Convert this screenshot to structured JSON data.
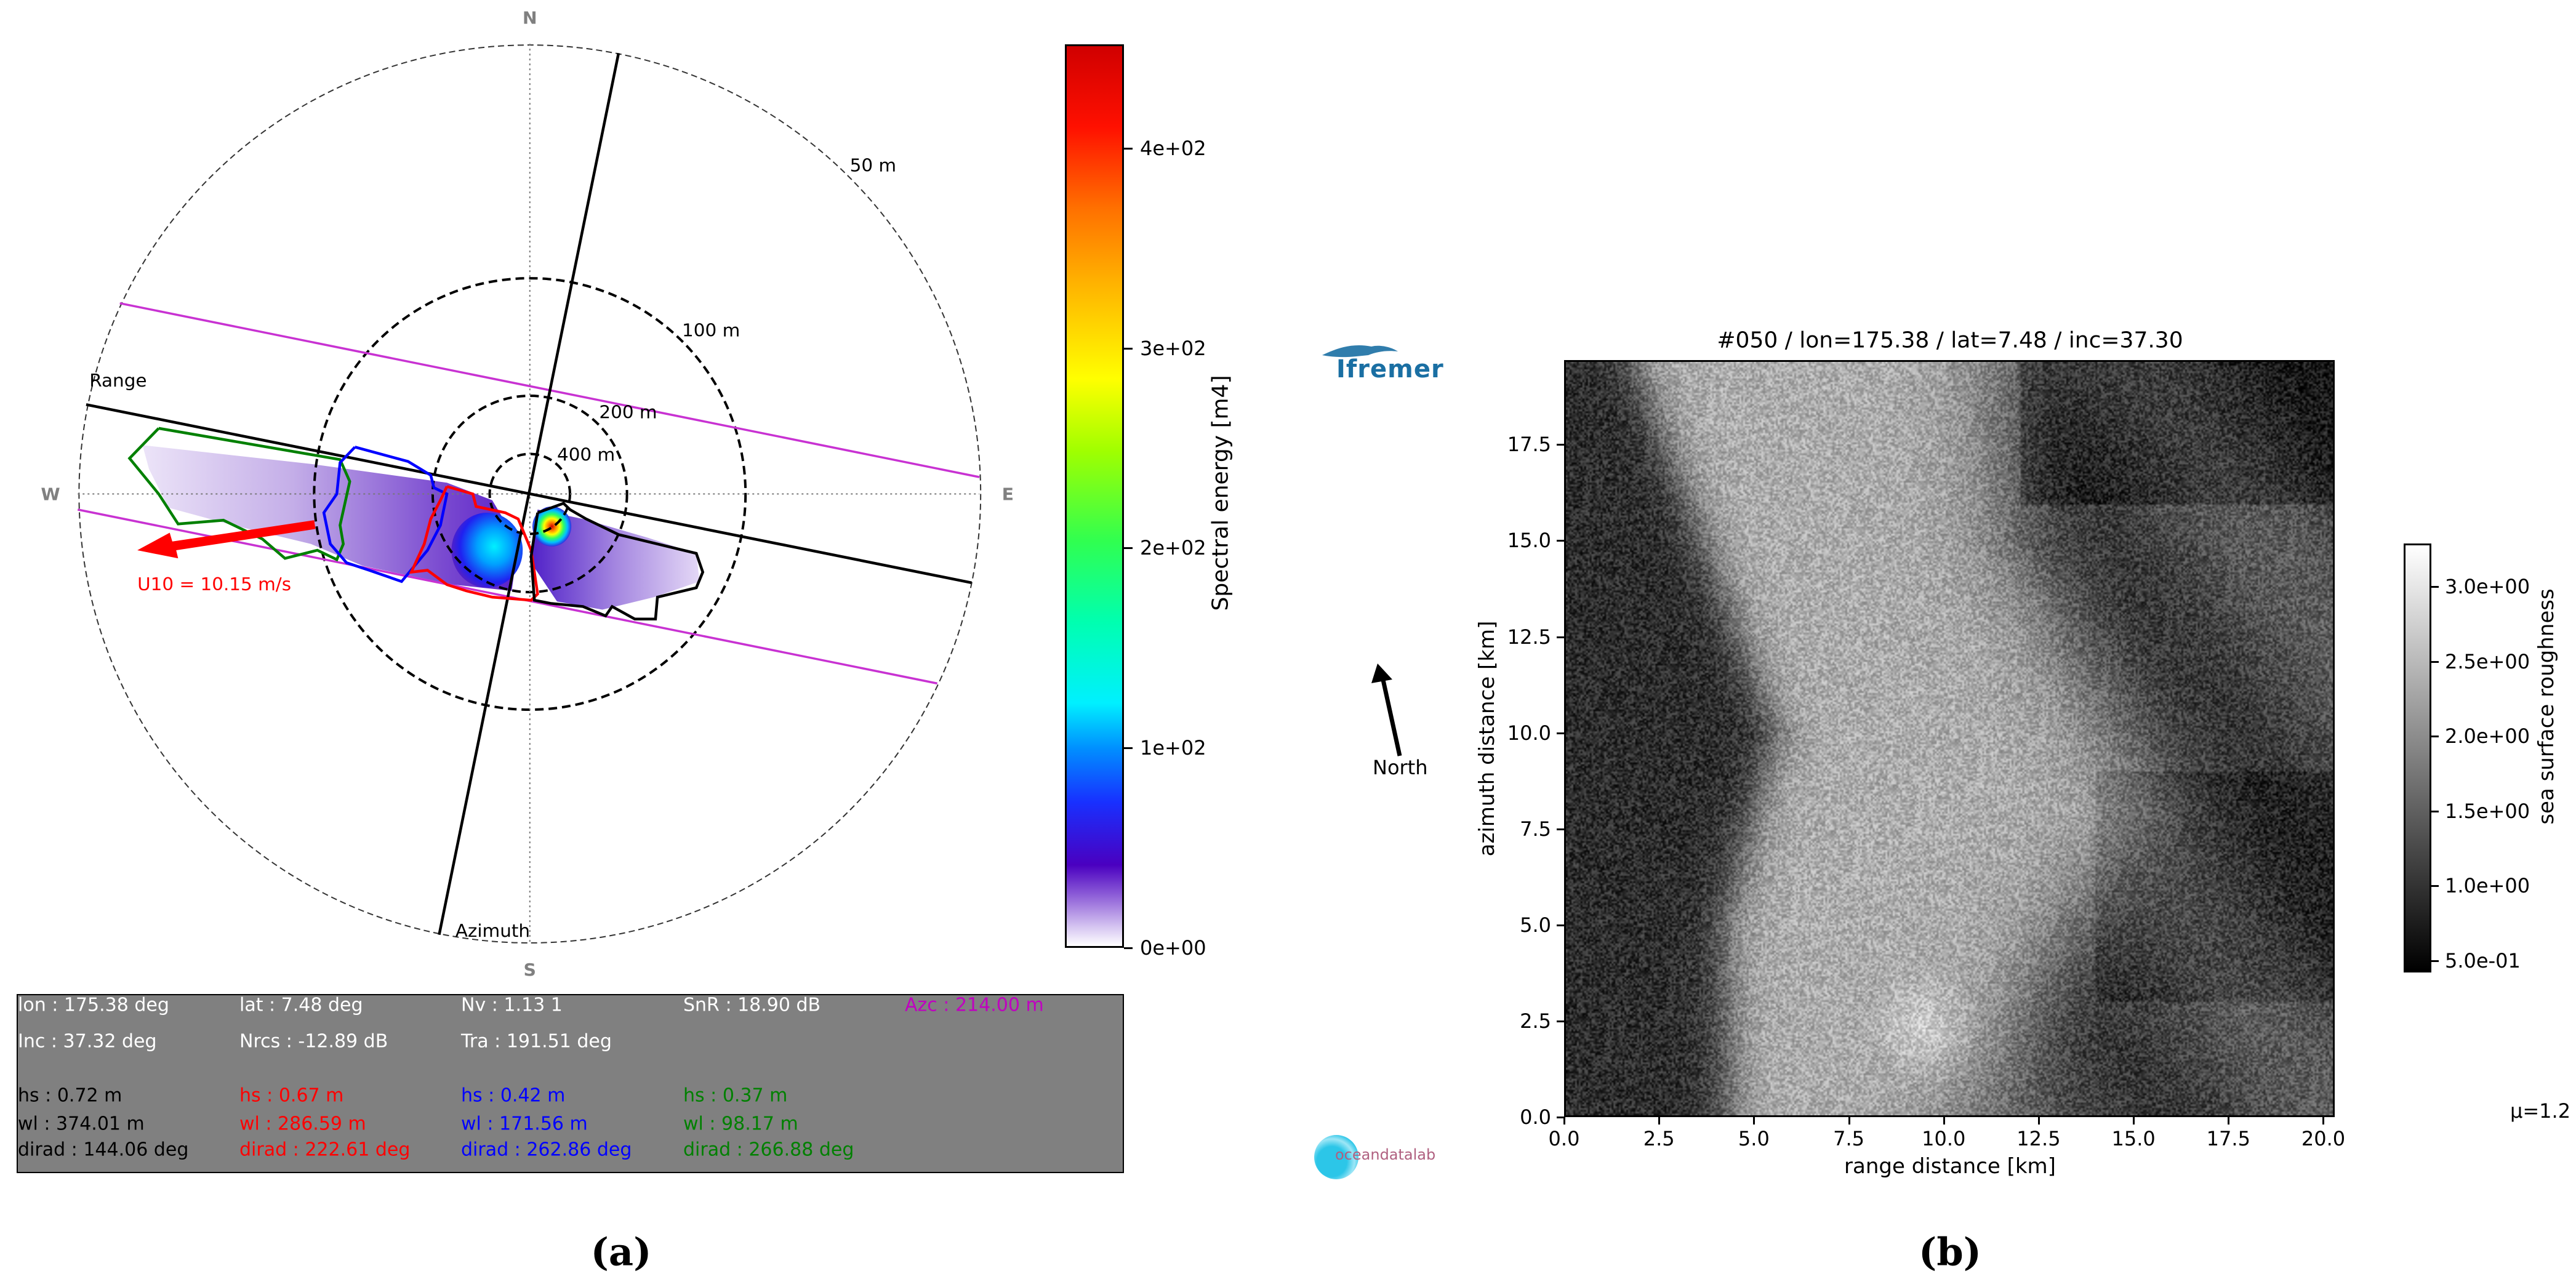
{
  "colors": {
    "hot": "#ff0000",
    "blue": "#0000ff",
    "green": "#008000",
    "magenta": "#c000c0",
    "black": "#000000",
    "panel": "#808080",
    "ifremer": "#1a6fa3",
    "odl_text": "#b06080",
    "odl_globe": "#2cc6e8"
  },
  "polar": {
    "compass": {
      "n": "N",
      "s": "S",
      "w": "W",
      "e": "E"
    },
    "rings": [
      "50 m",
      "100 m",
      "200 m",
      "400 m"
    ],
    "range_label": "Range",
    "azimuth_label": "Azimuth",
    "wind_label": "U10 = 10.15 m/s"
  },
  "info": {
    "row1": [
      "lon : 175.38 deg",
      "lat : 7.48 deg",
      "Nv : 1.13 1",
      "SnR : 18.90 dB",
      "Azc : 214.00 m"
    ],
    "row2": [
      "Inc : 37.32 deg",
      "Nrcs : -12.89 dB",
      "Tra : 191.51 deg"
    ],
    "partitions": [
      {
        "hs": "hs : 0.72 m",
        "wl": "wl : 374.01 m",
        "dirad": "dirad : 144.06 deg",
        "color": "#000000"
      },
      {
        "hs": "hs : 0.67 m",
        "wl": "wl : 286.59 m",
        "dirad": "dirad : 222.61 deg",
        "color": "#ff0000"
      },
      {
        "hs": "hs : 0.42 m",
        "wl": "wl : 171.56 m",
        "dirad": "dirad : 262.86 deg",
        "color": "#0000ff"
      },
      {
        "hs": "hs : 0.37 m",
        "wl": "wl : 98.17 m",
        "dirad": "dirad : 266.88 deg",
        "color": "#008000"
      }
    ]
  },
  "logos": {
    "ifremer": "Ifremer",
    "oceandatalab": "oceandatalab"
  },
  "north_label": "North",
  "panel_labels": [
    "(a)",
    "(b)"
  ],
  "chart_data": [
    {
      "type": "polar-spectrum",
      "colorbar": {
        "label": "Spectral energy [m4]",
        "ticks": [
          0,
          100,
          200,
          300,
          400
        ],
        "tick_labels": [
          "0e+00",
          "1e+02",
          "2e+02",
          "3e+02",
          "4e+02"
        ],
        "range": [
          0,
          452
        ]
      },
      "wind_speed_ms": 10.15
    },
    {
      "type": "heatmap",
      "title": "#050 / lon=175.38 / lat=7.48 / inc=37.30",
      "xlabel": "range distance [km]",
      "ylabel": "azimuth distance [km]",
      "xlim": [
        0,
        20.3
      ],
      "ylim": [
        0,
        19.7
      ],
      "xticks": [
        "0.0",
        "2.5",
        "5.0",
        "7.5",
        "10.0",
        "12.5",
        "15.0",
        "17.5",
        "20.0"
      ],
      "yticks": [
        "0.0",
        "2.5",
        "5.0",
        "7.5",
        "10.0",
        "12.5",
        "15.0",
        "17.5"
      ],
      "colorbar": {
        "label": "sea surface roughness",
        "ticks": [
          0.5,
          1.0,
          1.5,
          2.0,
          2.5,
          3.0
        ],
        "tick_labels": [
          "5.0e-01",
          "1.0e+00",
          "1.5e+00",
          "2.0e+00",
          "2.5e+00",
          "3.0e+00"
        ],
        "range": [
          0.42,
          3.29
        ]
      },
      "annotation": "μ=1.2"
    }
  ]
}
